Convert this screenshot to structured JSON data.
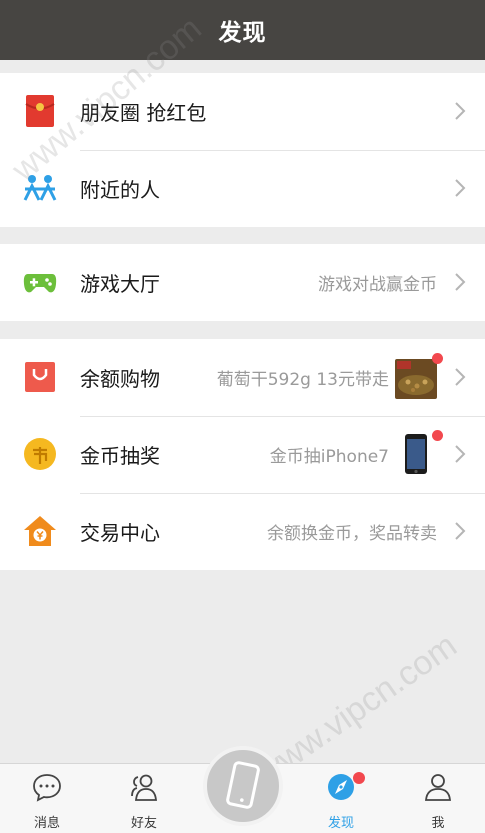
{
  "header": {
    "title": "发现"
  },
  "groups": [
    {
      "items": [
        {
          "label": "朋友圈  抢红包",
          "sub": "",
          "icon": "red-envelope-icon",
          "color": "#e23a2f"
        },
        {
          "label": "附近的人",
          "sub": "",
          "icon": "people-nearby-icon",
          "color": "#2ea0e6"
        }
      ]
    },
    {
      "items": [
        {
          "label": "游戏大厅",
          "sub": "游戏对战赢金币",
          "icon": "gamepad-icon",
          "color": "#6cbf3b"
        }
      ]
    },
    {
      "items": [
        {
          "label": "余额购物",
          "sub": "葡萄干592g 13元带走",
          "icon": "shopping-bag-icon",
          "color": "#ee5a4c",
          "thumb": "raisins-thumbnail"
        },
        {
          "label": "金币抽奖",
          "sub": "金币抽iPhone7",
          "icon": "coin-icon",
          "color": "#f5b820",
          "thumb": "iphone-thumbnail"
        },
        {
          "label": "交易中心",
          "sub": "余额换金币，奖品转卖",
          "icon": "house-yen-icon",
          "color": "#f08b1c"
        }
      ]
    }
  ],
  "tabbar": [
    {
      "label": "消息",
      "icon": "chat-bubble-icon"
    },
    {
      "label": "好友",
      "icon": "friends-icon"
    },
    {
      "label": "发现",
      "icon": "compass-icon",
      "active": true
    },
    {
      "label": "我",
      "icon": "person-icon"
    }
  ],
  "center_button": {
    "icon": "phone-icon"
  },
  "watermark": {
    "text": "www.vipcn.com"
  },
  "colors": {
    "header_bg": "#474542",
    "accent": "#2ea0e6",
    "badge": "#f2484e",
    "page_bg": "#ececec"
  }
}
